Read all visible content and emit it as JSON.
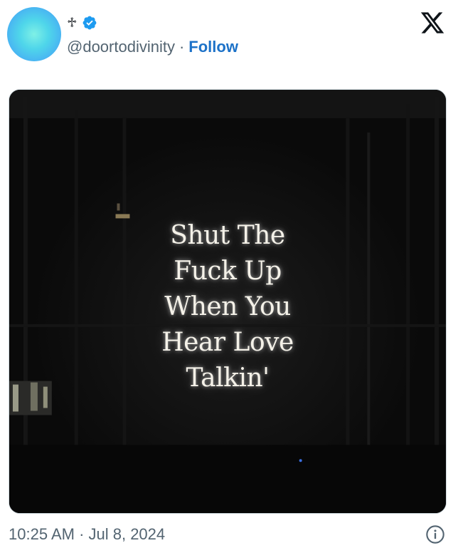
{
  "author": {
    "display_name": "♱",
    "handle": "@doortodivinity",
    "separator": "·",
    "follow_label": "Follow",
    "verified_icon": "verified-badge-icon",
    "verified_color": "#1d9bf0"
  },
  "brand": {
    "logo_icon": "x-logo-icon"
  },
  "media": {
    "sign_lines": [
      "Shut The",
      "Fuck Up",
      "When You",
      "Hear Love",
      "Talkin'"
    ]
  },
  "footer": {
    "timestamp": "10:25 AM · Jul 8, 2024",
    "info_icon": "info-icon"
  },
  "colors": {
    "follow": "#1d72c8",
    "secondary_text": "#536471",
    "photo_background": "#0c0c0c"
  }
}
